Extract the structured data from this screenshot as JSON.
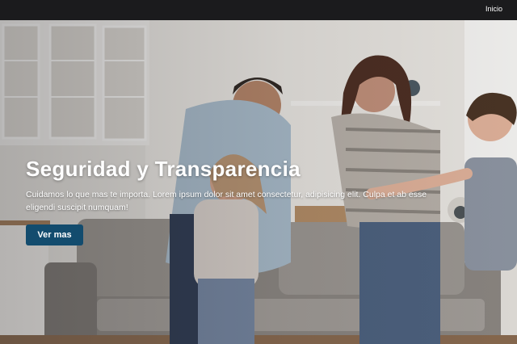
{
  "nav": {
    "home_label": "Inicio"
  },
  "hero": {
    "title": "Seguridad y Transparencia",
    "text": "Cuidamos lo que mas te importa. Lorem ipsum dolor sit amet consectetur, adipisicing elit. Culpa et ab esse eligendi suscipit numquam!",
    "cta_label": "Ver mas",
    "cta_color": "#134c6e"
  }
}
